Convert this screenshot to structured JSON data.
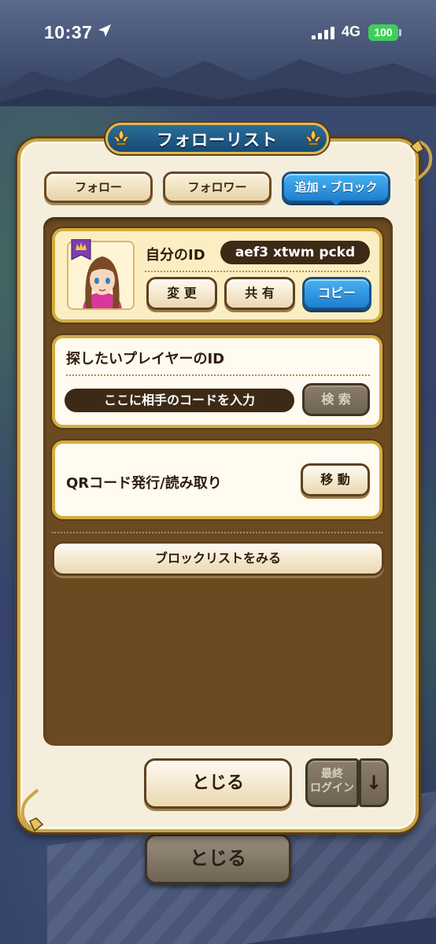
{
  "status_bar": {
    "time": "10:37",
    "network": "4G",
    "battery": "100"
  },
  "dialog": {
    "title": "フォローリスト",
    "tabs": [
      {
        "label": "フォロー",
        "active": false
      },
      {
        "label": "フォロワー",
        "active": false
      },
      {
        "label": "追加・ブロック",
        "active": true
      }
    ]
  },
  "my_id": {
    "label": "自分のID",
    "value": "aef3 xtwm pckd",
    "buttons": {
      "change": "変 更",
      "share": "共 有",
      "copy": "コピー"
    }
  },
  "search": {
    "label": "探したいプレイヤーのID",
    "input_placeholder": "ここに相手のコードを入力",
    "button": "検 索"
  },
  "qr": {
    "label": "QRコード発行/読み取り",
    "button": "移 動"
  },
  "block_list_button": "ブロックリストをみる",
  "footer": {
    "close": "とじる",
    "sort_line1": "最終",
    "sort_line2": "ログイン",
    "sort_arrow": "↓"
  },
  "background_close": "とじる",
  "colors": {
    "active_tab": "#1c7fd0",
    "panel_brown": "#6b4a21",
    "gold_border": "#d2ad3f",
    "title_blue": "#1d5a86"
  }
}
